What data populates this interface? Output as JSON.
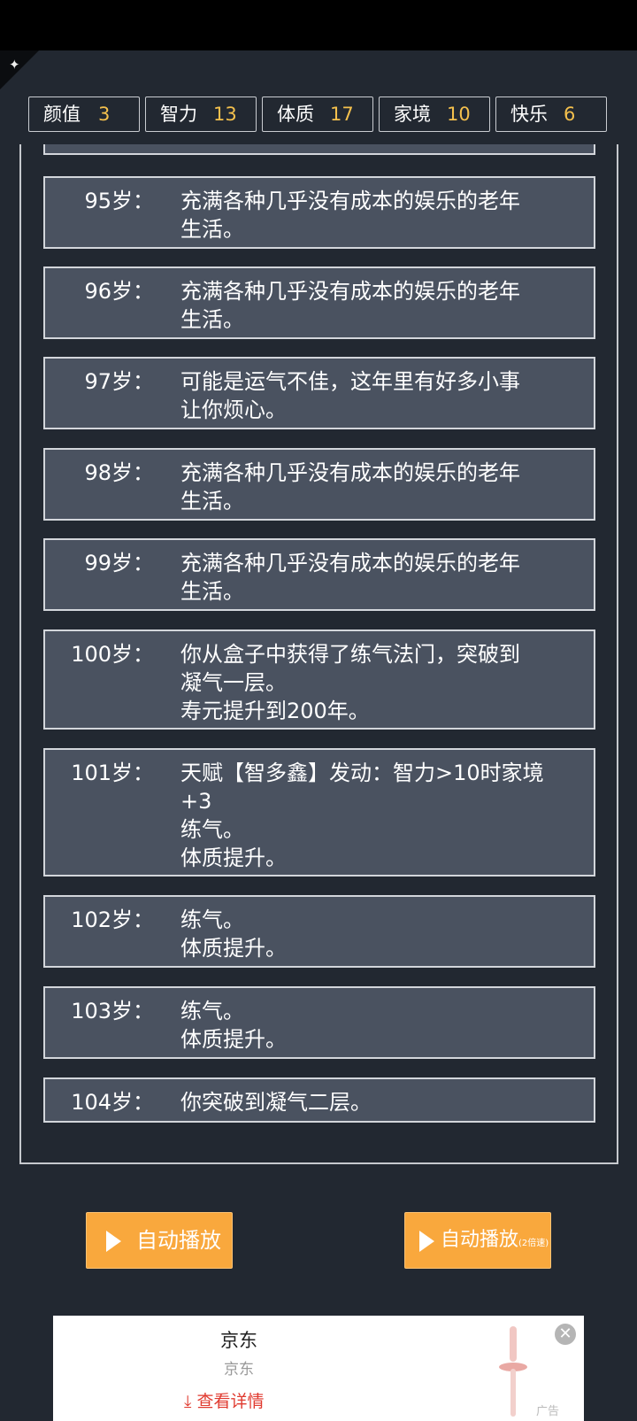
{
  "stats": [
    {
      "label": "颜值",
      "value": "3"
    },
    {
      "label": "智力",
      "value": "13"
    },
    {
      "label": "体质",
      "value": "17"
    },
    {
      "label": "家境",
      "value": "10"
    },
    {
      "label": "快乐",
      "value": "6"
    }
  ],
  "log": [
    {
      "age": "95岁：",
      "text": "充满各种几乎没有成本的娱乐的老年\n生活。"
    },
    {
      "age": "96岁：",
      "text": "充满各种几乎没有成本的娱乐的老年\n生活。"
    },
    {
      "age": "97岁：",
      "text": "可能是运气不佳，这年里有好多小事\n让你烦心。"
    },
    {
      "age": "98岁：",
      "text": "充满各种几乎没有成本的娱乐的老年\n生活。"
    },
    {
      "age": "99岁：",
      "text": "充满各种几乎没有成本的娱乐的老年\n生活。"
    },
    {
      "age": "100岁：",
      "text": "你从盒子中获得了练气法门，突破到\n凝气一层。\n寿元提升到200年。"
    },
    {
      "age": "101岁：",
      "text": "天赋【智多鑫】发动：智力>10时家境\n+3\n练气。\n体质提升。"
    },
    {
      "age": "102岁：",
      "text": "练气。\n体质提升。"
    },
    {
      "age": "103岁：",
      "text": "练气。\n体质提升。"
    },
    {
      "age": "104岁：",
      "text": "你突破到凝气二层。"
    }
  ],
  "buttons": {
    "autoplay": "自动播放",
    "autoplay_fast": "自动播放",
    "autoplay_fast_suffix": "(2倍速)"
  },
  "ad": {
    "title": "京东",
    "subtitle": "京东",
    "link": "查看详情",
    "tag": "广告"
  }
}
